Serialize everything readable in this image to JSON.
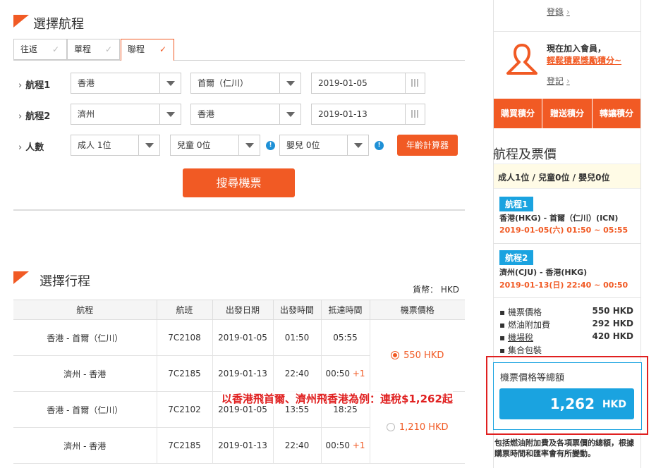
{
  "select_flight": {
    "title": "選擇航程",
    "tabs": [
      {
        "label": "往返",
        "active": false
      },
      {
        "label": "單程",
        "active": false
      },
      {
        "label": "聯程",
        "active": true
      }
    ],
    "check_glyph": "✓",
    "rows": [
      {
        "label": "航程1",
        "from": "香港",
        "to": "首爾（仁川）",
        "date": "2019-01-05"
      },
      {
        "label": "航程2",
        "from": "濟州",
        "to": "香港",
        "date": "2019-01-13"
      }
    ],
    "pax": {
      "label": "人數",
      "adult": "成人 1位",
      "child": "兒童 0位",
      "infant": "嬰兒 0位",
      "age_calc": "年齡計算器",
      "info_glyph": "!"
    },
    "search_button": "搜尋機票"
  },
  "itinerary": {
    "title": "選擇行程",
    "currency": "貨幣： HKD",
    "headers": [
      "航程",
      "航班",
      "出發日期",
      "出發時間",
      "抵達時間",
      "機票價格"
    ],
    "groups": [
      {
        "price": "550 HKD",
        "selected": true,
        "rows": [
          {
            "route": "香港 - 首爾（仁川）",
            "flight": "7C2108",
            "date": "2019-01-05",
            "dep": "01:50",
            "arr": "05:55",
            "plus": ""
          },
          {
            "route": "濟州 - 香港",
            "flight": "7C2185",
            "date": "2019-01-13",
            "dep": "22:40",
            "arr": "00:50",
            "plus": "+1"
          }
        ]
      },
      {
        "price": "1,210 HKD",
        "selected": false,
        "rows": [
          {
            "route": "香港 - 首爾（仁川）",
            "flight": "7C2102",
            "date": "2019-01-05",
            "dep": "13:55",
            "arr": "18:25",
            "plus": ""
          },
          {
            "route": "濟州 - 香港",
            "flight": "7C2185",
            "date": "2019-01-13",
            "dep": "22:40",
            "arr": "00:50",
            "plus": "+1"
          }
        ]
      }
    ],
    "annotation": "以香港飛首爾、濟州飛香港為例：連稅$1,262起"
  },
  "sidebar": {
    "login_link": "登錄",
    "join_text": "現在加入會員，",
    "join_highlight": "輕鬆積累獎勵積分~",
    "signup_link": "登記",
    "chev": "›",
    "point_buttons": [
      "購買積分",
      "贈送積分",
      "轉讓積分"
    ],
    "fare_title": "航程及票價",
    "pax_summary": "成人1位 / 兒童0位 / 嬰兒0位",
    "segments": [
      {
        "badge": "航程1",
        "route": "香港(HKG) - 首爾（仁川）(ICN)",
        "time": "2019-01-05(六) 01:50 ~ 05:55"
      },
      {
        "badge": "航程2",
        "route": "濟州(CJU) - 香港(HKG)",
        "time": "2019-01-13(日) 22:40 ~ 00:50"
      }
    ],
    "fees": [
      {
        "label": "機票價格",
        "value": "550 HKD",
        "link": false
      },
      {
        "label": "燃油附加費",
        "value": "292 HKD",
        "link": false
      },
      {
        "label": "機場稅",
        "value": "420 HKD",
        "link": true
      },
      {
        "label": "集合包裝",
        "value": "",
        "link": false
      }
    ],
    "total_label": "機票價格等總額",
    "total_amount": "1,262",
    "total_currency": "HKD",
    "footnote": "包括燃油附加費及各項票價的總額，根據購票時間和匯率會有所變動。"
  },
  "colors": {
    "accent": "#f15a24",
    "blue": "#1aa3e0",
    "highlight_box": "#e02020"
  }
}
